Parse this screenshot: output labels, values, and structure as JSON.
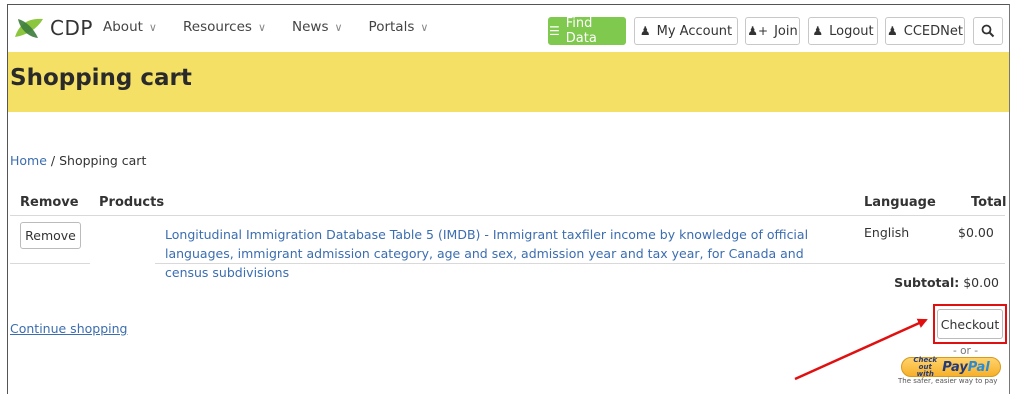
{
  "header": {
    "logo_text": "CDP",
    "menu": [
      {
        "label": "About"
      },
      {
        "label": "Resources"
      },
      {
        "label": "News"
      },
      {
        "label": "Portals"
      }
    ],
    "buttons": {
      "find_data": "Find Data",
      "my_account": "My Account",
      "join": "Join",
      "logout": "Logout",
      "ccednet": "CCEDNet"
    }
  },
  "page": {
    "title": "Shopping cart"
  },
  "breadcrumb": {
    "home": "Home",
    "separator": " / ",
    "current": "Shopping cart"
  },
  "cart": {
    "headers": {
      "remove": "Remove",
      "products": "Products",
      "language": "Language",
      "total": "Total"
    },
    "items": [
      {
        "remove_label": "Remove",
        "product": "Longitudinal Immigration Database Table 5 (IMDB) - Immigrant taxfiler income by knowledge of official languages, immigrant admission category, age and sex, admission year and tax year, for Canada and census subdivisions",
        "language": "English",
        "total": "$0.00"
      }
    ],
    "subtotal_label": "Subtotal:",
    "subtotal_value": " $0.00"
  },
  "actions": {
    "continue_shopping": "Continue shopping",
    "checkout": "Checkout",
    "or": "- or -",
    "paypal_small": "Check out with",
    "paypal_brand_pay": "Pay",
    "paypal_brand_pal": "Pal",
    "paypal_tagline": "The safer, easier way to pay"
  },
  "colors": {
    "band": "#f5e066",
    "link": "#3b6db0",
    "find_data": "#7fc94e",
    "highlight": "#e01010"
  }
}
